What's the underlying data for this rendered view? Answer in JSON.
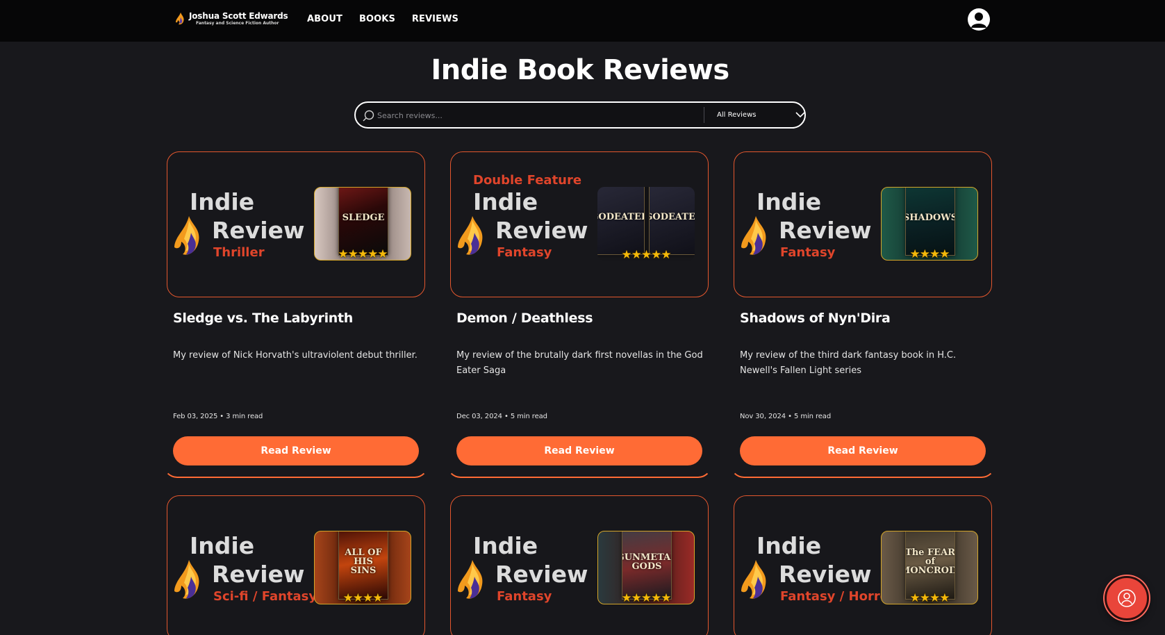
{
  "nav": {
    "logo_name": "Joshua Scott Edwards",
    "logo_subtitle": "Fantasy and Science Fiction Author",
    "links": [
      "ABOUT",
      "BOOKS",
      "REVIEWS"
    ]
  },
  "header": {
    "title": "Indie Book Reviews",
    "search_placeholder": "Search reviews...",
    "filter_label": "All Reviews"
  },
  "banner_words": {
    "indie": "Indie",
    "review": "Review"
  },
  "colors": {
    "accent": "#ff6b35",
    "background": "#18181c",
    "genre": "#e0452b",
    "star": "#f5b90a"
  },
  "cards": [
    {
      "feature": "",
      "genre": "Thriller",
      "covers": [
        "SLEDGE"
      ],
      "title": "Sledge vs. The Labyrinth",
      "description": "My review of Nick Horvath's ultraviolent debut thriller.",
      "meta": "Feb 03, 2025 • 3 min read",
      "rating": 5,
      "button": "Read Review"
    },
    {
      "feature": "Double Feature",
      "genre": "Fantasy",
      "covers": [
        "GODEATER",
        "GODEATER"
      ],
      "title": "Demon / Deathless",
      "description": "My review of the brutally dark first novellas in the God Eater Saga",
      "meta": "Dec 03, 2024 • 5 min read",
      "rating": 5,
      "button": "Read Review"
    },
    {
      "feature": "",
      "genre": "Fantasy",
      "covers": [
        "SHADOWS"
      ],
      "title": "Shadows of Nyn'Dira",
      "description": "My review of the third dark fantasy book in H.C. Newell's Fallen Light series",
      "meta": "Nov 30, 2024 • 5 min read",
      "rating": 4,
      "button": "Read Review"
    },
    {
      "feature": "",
      "genre": "Sci-fi / Fantasy",
      "covers": [
        "ALL OF HIS SINS"
      ],
      "title": "",
      "description": "",
      "meta": "",
      "rating": 4,
      "button": ""
    },
    {
      "feature": "",
      "genre": "Fantasy",
      "covers": [
        "GUNMETAL GODS"
      ],
      "title": "",
      "description": "",
      "meta": "",
      "rating": 5,
      "button": ""
    },
    {
      "feature": "",
      "genre": "Fantasy / Horror",
      "covers": [
        "The FEAR of MONCROIX"
      ],
      "title": "",
      "description": "",
      "meta": "",
      "rating": 4,
      "button": ""
    }
  ]
}
